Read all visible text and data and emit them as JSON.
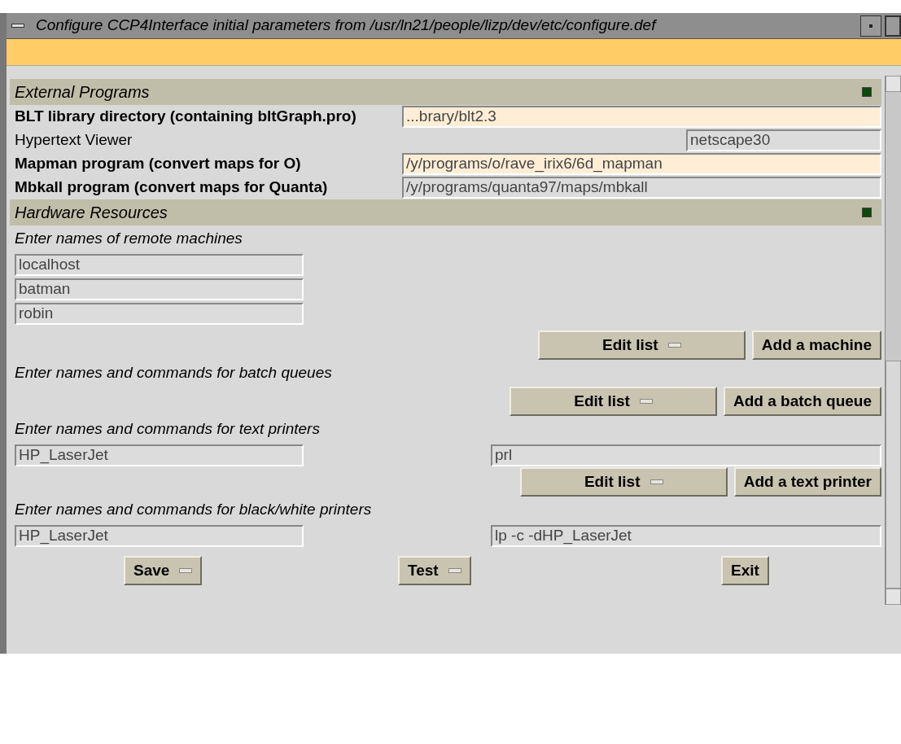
{
  "window": {
    "title": "Configure CCP4Interface initial parameters from /usr/ln21/people/lizp/dev/etc/configure.def"
  },
  "sections": [
    {
      "title": "External Programs",
      "expanded": true,
      "rows": [
        {
          "kind": "param",
          "label": "BLT library directory (containing bltGraph.pro)",
          "value": "...brary/blt2.3",
          "highlighted": true
        },
        {
          "kind": "param_short",
          "label": "Hypertext Viewer",
          "value": "netscape30",
          "highlighted": false
        },
        {
          "kind": "param",
          "label": "Mapman program (convert maps for O)",
          "value": "/y/programs/o/rave_irix6/6d_mapman",
          "highlighted": true
        },
        {
          "kind": "param",
          "label": "Mbkall program (convert maps for Quanta)",
          "value": "/y/programs/quanta97/maps/mbkall",
          "highlighted": false
        }
      ]
    },
    {
      "title": "Hardware Resources",
      "expanded": true,
      "groups": [
        {
          "kind": "names",
          "label": "Enter names of remote machines",
          "entries": [
            {
              "name": "localhost"
            },
            {
              "name": "batman"
            },
            {
              "name": "robin"
            }
          ],
          "edit_button": "Edit list",
          "add_button": "Add a machine"
        },
        {
          "kind": "commands",
          "label": "Enter names and commands for batch queues",
          "edit_button": "Edit list",
          "add_button": "Add a batch queue"
        },
        {
          "kind": "commands",
          "label": "Enter names and commands for text printers",
          "entries": [
            {
              "name": "HP_LaserJet",
              "command": "prl"
            }
          ],
          "edit_button": "Edit list",
          "add_button": "Add a text printer"
        },
        {
          "kind": "commands",
          "label": "Enter names and commands for black/white printers",
          "entries": [
            {
              "name": "HP_LaserJet",
              "command": "lp -c -dHP_LaserJet"
            }
          ]
        }
      ]
    }
  ],
  "footer": [
    {
      "label": "Save",
      "menu": true
    },
    {
      "label": "Test",
      "menu": true
    },
    {
      "label": "Exit",
      "menu": false
    }
  ]
}
